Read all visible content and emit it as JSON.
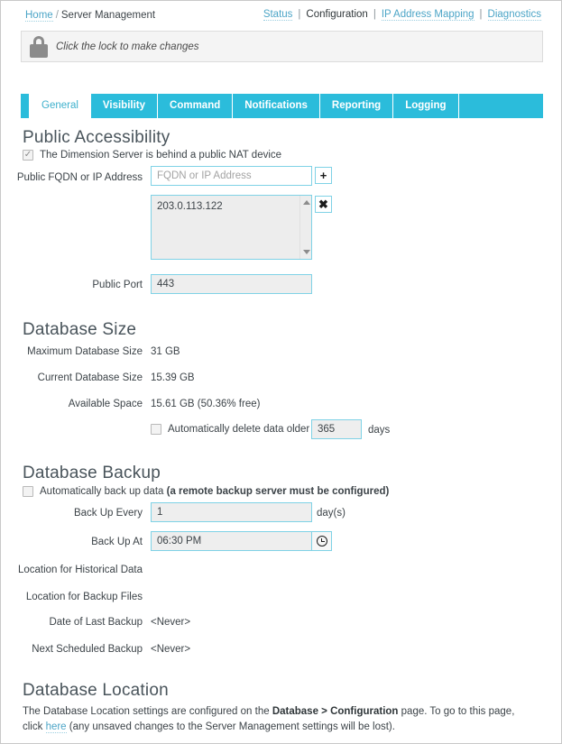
{
  "breadcrumb": {
    "home_label": "Home",
    "separator": "/",
    "current": "Server Management"
  },
  "toplinks": {
    "separator": "|",
    "items": [
      {
        "label": "Status",
        "active": false
      },
      {
        "label": "Configuration",
        "active": true
      },
      {
        "label": "IP Address Mapping",
        "active": false
      },
      {
        "label": "Diagnostics",
        "active": false
      }
    ]
  },
  "lockbar": {
    "icon": "lock-closed-icon",
    "message": "Click the lock to make changes"
  },
  "tabs": [
    {
      "label": "General",
      "active": true
    },
    {
      "label": "Visibility",
      "active": false
    },
    {
      "label": "Command",
      "active": false
    },
    {
      "label": "Notifications",
      "active": false
    },
    {
      "label": "Reporting",
      "active": false
    },
    {
      "label": "Logging",
      "active": false
    }
  ],
  "public_accessibility": {
    "heading": "Public Accessibility",
    "nat_checkbox_label": "The Dimension Server is behind a public NAT device",
    "nat_checked": true,
    "fqdn_label": "Public FQDN or IP Address",
    "fqdn_placeholder": "FQDN or IP Address",
    "fqdn_value": "",
    "add_button_label": "+",
    "remove_button_label": "✖",
    "address_list": [
      "203.0.113.122"
    ],
    "public_port_label": "Public Port",
    "public_port_value": "443"
  },
  "database_size": {
    "heading": "Database Size",
    "rows": [
      {
        "label": "Maximum Database Size",
        "value": "31 GB"
      },
      {
        "label": "Current Database Size",
        "value": "15.39 GB"
      },
      {
        "label": "Available Space",
        "value": "15.61 GB (50.36% free)"
      }
    ],
    "auto_delete_checked": false,
    "auto_delete_label": "Automatically delete data older than",
    "auto_delete_days": "365",
    "auto_delete_units": "days"
  },
  "database_backup": {
    "heading": "Database Backup",
    "auto_backup_checked": false,
    "auto_backup_label_plain": "Automatically back up data ",
    "auto_backup_label_bold": "(a remote backup server must be configured)",
    "backup_every_label": "Back Up Every",
    "backup_every_value": "1",
    "backup_every_units": "day(s)",
    "backup_at_label": "Back Up At",
    "backup_at_value": "06:30 PM",
    "clock_icon": "clock-icon",
    "historical_location_label": "Location for Historical Data",
    "historical_location_value": "",
    "backup_files_location_label": "Location for Backup Files",
    "backup_files_location_value": "",
    "last_backup_label": "Date of Last Backup",
    "last_backup_value": "<Never>",
    "next_backup_label": "Next Scheduled Backup",
    "next_backup_value": "<Never>"
  },
  "database_location": {
    "heading": "Database Location",
    "text_part1": "The Database Location settings are configured on the ",
    "text_bold": "Database > Configuration",
    "text_part2": " page. To go to this page, click ",
    "link": "here",
    "text_part3": " (any unsaved changes to the Server Management settings will be lost)."
  },
  "colors": {
    "accent": "#2bbcdb",
    "link": "#4ca5c7",
    "field_border": "#7fd2e6",
    "field_bg": "#eeeeee",
    "heading": "#49545b"
  }
}
